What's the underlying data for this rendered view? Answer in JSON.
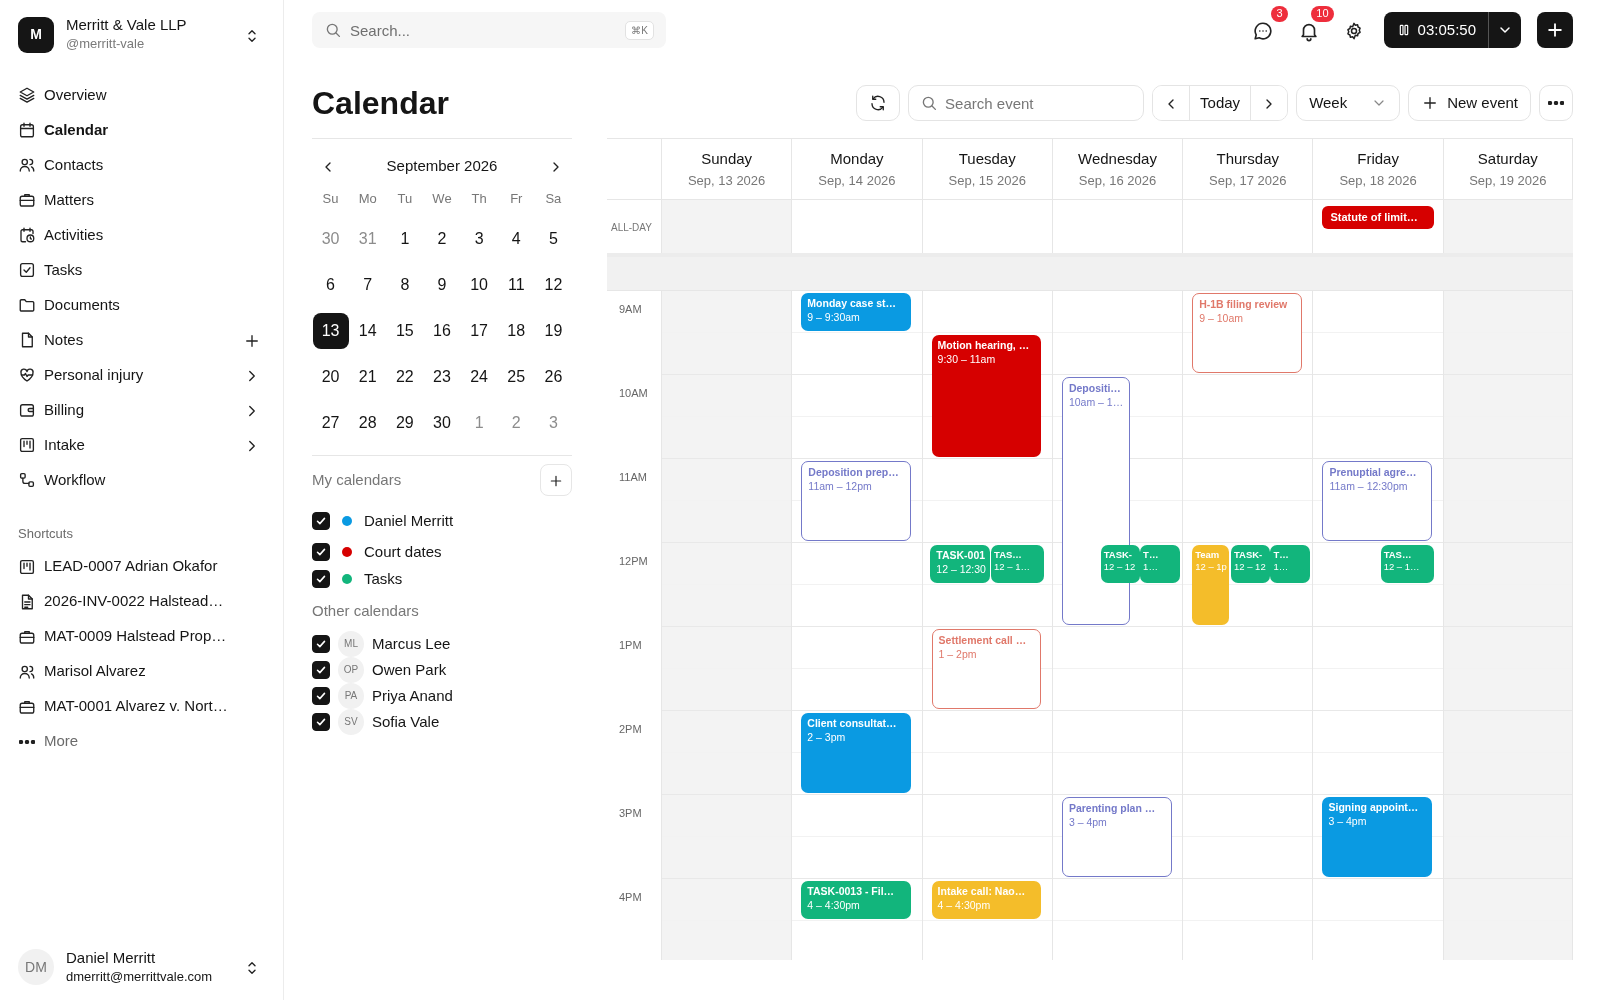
{
  "workspace": {
    "initial": "M",
    "name": "Merritt & Vale LLP",
    "handle": "@merritt-vale"
  },
  "nav": [
    {
      "label": "Overview",
      "selected": false,
      "kind": "link"
    },
    {
      "label": "Calendar",
      "selected": true,
      "kind": "link"
    },
    {
      "label": "Contacts",
      "selected": false,
      "kind": "link"
    },
    {
      "label": "Matters",
      "selected": false,
      "kind": "link"
    },
    {
      "label": "Activities",
      "selected": false,
      "kind": "link"
    },
    {
      "label": "Tasks",
      "selected": false,
      "kind": "link"
    },
    {
      "label": "Documents",
      "selected": false,
      "kind": "link"
    },
    {
      "label": "Notes",
      "selected": false,
      "kind": "addable"
    },
    {
      "label": "Personal injury",
      "selected": false,
      "kind": "group"
    },
    {
      "label": "Billing",
      "selected": false,
      "kind": "group"
    },
    {
      "label": "Intake",
      "selected": false,
      "kind": "group"
    },
    {
      "label": "Workflow",
      "selected": false,
      "kind": "link"
    }
  ],
  "shortcuts_heading": "Shortcuts",
  "shortcuts": [
    {
      "label": "LEAD-0007 Adrian Okafor"
    },
    {
      "label": "2026-INV-0022 Halstead…"
    },
    {
      "label": "MAT-0009 Halstead Prop…"
    },
    {
      "label": "Marisol Alvarez"
    },
    {
      "label": "MAT-0001 Alvarez v. Nort…"
    }
  ],
  "more": "More",
  "user": {
    "initials": "DM",
    "name": "Daniel Merritt",
    "email": "dmerritt@merrittvale.com"
  },
  "topbar": {
    "search": {
      "placeholder": "Search...",
      "shortcut": "⌘K"
    },
    "messages_badge": "3",
    "notifications_badge": "10",
    "timer": "03:05:50"
  },
  "header": {
    "title": "Calendar",
    "search": {
      "placeholder": "Search event"
    },
    "today": "Today",
    "view": "Week",
    "new_event": "New event"
  },
  "mini_calendar": {
    "month": "September 2026",
    "weekdays": [
      "Su",
      "Mo",
      "Tu",
      "We",
      "Th",
      "Fr",
      "Sa"
    ],
    "weeks": [
      [
        {
          "label": "30",
          "muted": true,
          "selected": false
        },
        {
          "label": "31",
          "muted": true,
          "selected": false
        },
        {
          "label": "1",
          "muted": false,
          "selected": false
        },
        {
          "label": "2",
          "muted": false,
          "selected": false
        },
        {
          "label": "3",
          "muted": false,
          "selected": false
        },
        {
          "label": "4",
          "muted": false,
          "selected": false
        },
        {
          "label": "5",
          "muted": false,
          "selected": false
        }
      ],
      [
        {
          "label": "6",
          "muted": false,
          "selected": false
        },
        {
          "label": "7",
          "muted": false,
          "selected": false
        },
        {
          "label": "8",
          "muted": false,
          "selected": false
        },
        {
          "label": "9",
          "muted": false,
          "selected": false
        },
        {
          "label": "10",
          "muted": false,
          "selected": false
        },
        {
          "label": "11",
          "muted": false,
          "selected": false
        },
        {
          "label": "12",
          "muted": false,
          "selected": false
        }
      ],
      [
        {
          "label": "13",
          "muted": false,
          "selected": true
        },
        {
          "label": "14",
          "muted": false,
          "selected": false
        },
        {
          "label": "15",
          "muted": false,
          "selected": false
        },
        {
          "label": "16",
          "muted": false,
          "selected": false
        },
        {
          "label": "17",
          "muted": false,
          "selected": false
        },
        {
          "label": "18",
          "muted": false,
          "selected": false
        },
        {
          "label": "19",
          "muted": false,
          "selected": false
        }
      ],
      [
        {
          "label": "20",
          "muted": false,
          "selected": false
        },
        {
          "label": "21",
          "muted": false,
          "selected": false
        },
        {
          "label": "22",
          "muted": false,
          "selected": false
        },
        {
          "label": "23",
          "muted": false,
          "selected": false
        },
        {
          "label": "24",
          "muted": false,
          "selected": false
        },
        {
          "label": "25",
          "muted": false,
          "selected": false
        },
        {
          "label": "26",
          "muted": false,
          "selected": false
        }
      ],
      [
        {
          "label": "27",
          "muted": false,
          "selected": false
        },
        {
          "label": "28",
          "muted": false,
          "selected": false
        },
        {
          "label": "29",
          "muted": false,
          "selected": false
        },
        {
          "label": "30",
          "muted": false,
          "selected": false
        },
        {
          "label": "1",
          "muted": true,
          "selected": false
        },
        {
          "label": "2",
          "muted": true,
          "selected": false
        },
        {
          "label": "3",
          "muted": true,
          "selected": false
        }
      ]
    ]
  },
  "my_calendars": {
    "title": "My calendars",
    "items": [
      {
        "name": "Daniel Merritt",
        "checked": true,
        "color": "#0a9ae2"
      },
      {
        "name": "Court dates",
        "checked": true,
        "color": "#d60000"
      },
      {
        "name": "Tasks",
        "checked": true,
        "color": "#12b57c"
      }
    ]
  },
  "other_calendars": {
    "title": "Other calendars",
    "items": [
      {
        "initials": "ML",
        "name": "Marcus Lee",
        "checked": true
      },
      {
        "initials": "OP",
        "name": "Owen Park",
        "checked": true
      },
      {
        "initials": "PA",
        "name": "Priya Anand",
        "checked": true
      },
      {
        "initials": "SV",
        "name": "Sofia Vale",
        "checked": true
      }
    ]
  },
  "week": {
    "all_day_label": "ALL-DAY",
    "hours": [
      "9AM",
      "10AM",
      "11AM",
      "12PM",
      "1PM",
      "2PM",
      "3PM",
      "4PM"
    ],
    "days": [
      {
        "name": "Sunday",
        "date": "Sep, 13 2026",
        "weekend": true
      },
      {
        "name": "Monday",
        "date": "Sep, 14 2026",
        "weekend": false,
        "events": [
          {
            "title": "Monday case st…",
            "time": "9 – 9:30am",
            "kind": "filled",
            "color": "#0a9ae2"
          },
          {
            "title": "Deposition prep…",
            "time": "11am – 12pm",
            "kind": "outlined",
            "color": "#7479c9"
          },
          {
            "title": "Client consultat…",
            "time": "2 – 3pm",
            "kind": "filled",
            "color": "#0a9ae2"
          },
          {
            "title": "TASK-0013 - Fil…",
            "time": "4 – 4:30pm",
            "kind": "filled",
            "color": "#12b57c"
          }
        ]
      },
      {
        "name": "Tuesday",
        "date": "Sep, 15 2026",
        "weekend": false,
        "events": [
          {
            "title": "Motion hearing, …",
            "time": "9:30 – 11am",
            "kind": "filled",
            "color": "#d60000"
          },
          {
            "title": "TASK-001",
            "time": "12 – 12:30",
            "kind": "filled",
            "color": "#12b57c"
          },
          {
            "title": "TAS…",
            "time": "12 – 1…",
            "kind": "filled",
            "color": "#12b57c"
          },
          {
            "title": "Settlement call …",
            "time": "1 – 2pm",
            "kind": "outlined",
            "color": "#e0786a"
          },
          {
            "title": "Intake call: Nao…",
            "time": "4 – 4:30pm",
            "kind": "filled",
            "color": "#f4bd2a"
          }
        ]
      },
      {
        "name": "Wednesday",
        "date": "Sep, 16 2026",
        "weekend": false,
        "events": [
          {
            "title": "Depositi…",
            "time": "10am – 1…",
            "kind": "outlined",
            "color": "#7479c9"
          },
          {
            "title": "TASK-",
            "time": "12 – 12",
            "kind": "filled",
            "color": "#12b57c"
          },
          {
            "title": "T…",
            "time": "1…",
            "kind": "filled",
            "color": "#12b57c"
          },
          {
            "title": "Parenting plan …",
            "time": "3 – 4pm",
            "kind": "outlined",
            "color": "#7479c9"
          }
        ]
      },
      {
        "name": "Thursday",
        "date": "Sep, 17 2026",
        "weekend": false,
        "events": [
          {
            "title": "H-1B filing review",
            "time": "9 – 10am",
            "kind": "outlined",
            "color": "#e0786a"
          },
          {
            "title": "Team",
            "time": "12 – 1p",
            "kind": "filled",
            "color": "#f4bd2a"
          },
          {
            "title": "TASK-",
            "time": "12 – 12",
            "kind": "filled",
            "color": "#12b57c"
          },
          {
            "title": "T…",
            "time": "1…",
            "kind": "filled",
            "color": "#12b57c"
          }
        ]
      },
      {
        "name": "Friday",
        "date": "Sep, 18 2026",
        "weekend": false,
        "all_day": [
          {
            "title": "Statute of limit…",
            "color": "#d60000"
          }
        ],
        "events": [
          {
            "title": "Prenuptial agre…",
            "time": "11am – 12:30pm",
            "kind": "outlined",
            "color": "#7479c9"
          },
          {
            "title": "TAS…",
            "time": "12 – 1…",
            "kind": "filled",
            "color": "#12b57c"
          },
          {
            "title": "Signing appoint…",
            "time": "3 – 4pm",
            "kind": "filled",
            "color": "#0a9ae2"
          }
        ]
      },
      {
        "name": "Saturday",
        "date": "Sep, 19 2026",
        "weekend": true
      }
    ]
  }
}
